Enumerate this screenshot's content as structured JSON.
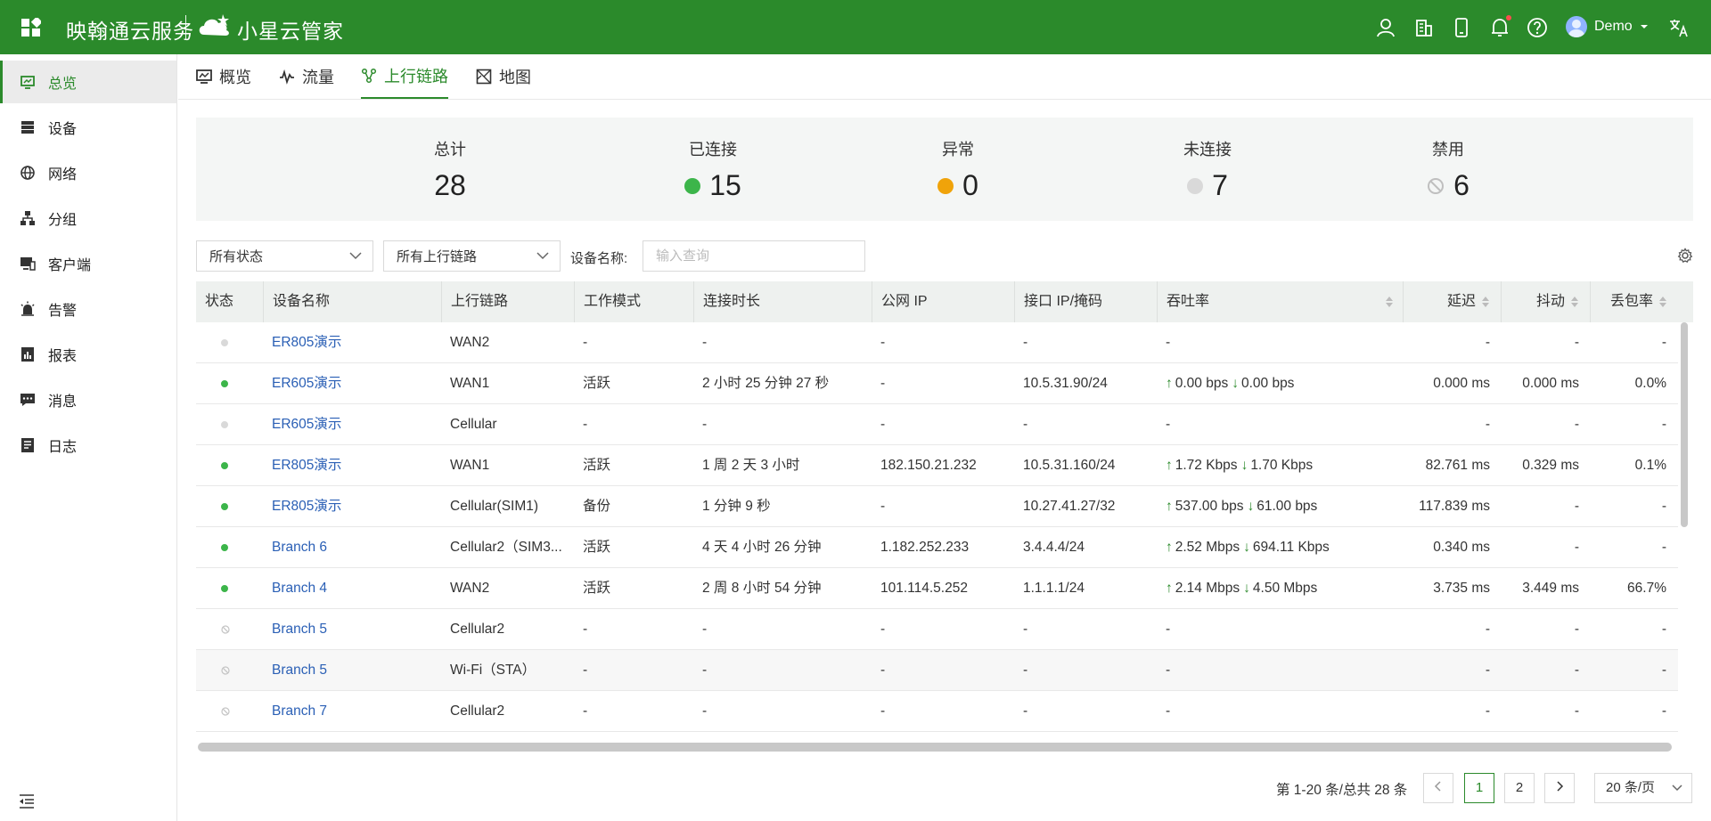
{
  "header": {
    "brand": "映翰通云服务",
    "product": "小星云管家",
    "user": "Demo",
    "accent": "#2b8a2b"
  },
  "sidebar": {
    "items": [
      {
        "label": "总览",
        "icon": "dashboard-icon",
        "active": true
      },
      {
        "label": "设备",
        "icon": "server-icon"
      },
      {
        "label": "网络",
        "icon": "globe-icon"
      },
      {
        "label": "分组",
        "icon": "hierarchy-icon"
      },
      {
        "label": "客户端",
        "icon": "client-icon"
      },
      {
        "label": "告警",
        "icon": "alarm-icon"
      },
      {
        "label": "报表",
        "icon": "report-icon"
      },
      {
        "label": "消息",
        "icon": "message-icon"
      },
      {
        "label": "日志",
        "icon": "log-icon"
      }
    ]
  },
  "tabs": [
    {
      "label": "概览",
      "icon": "monitor-icon"
    },
    {
      "label": "流量",
      "icon": "pulse-icon"
    },
    {
      "label": "上行链路",
      "icon": "uplink-icon",
      "active": true
    },
    {
      "label": "地图",
      "icon": "map-icon"
    }
  ],
  "stats": {
    "total": {
      "label": "总计",
      "value": "28"
    },
    "connected": {
      "label": "已连接",
      "value": "15",
      "color": "#3cb54a"
    },
    "abnormal": {
      "label": "异常",
      "value": "0",
      "color": "#f0a30a"
    },
    "disconnected": {
      "label": "未连接",
      "value": "7",
      "color": "#d9d9d9"
    },
    "disabled": {
      "label": "禁用",
      "value": "6",
      "color": "#bfbfbf"
    }
  },
  "filters": {
    "status": "所有状态",
    "uplink": "所有上行链路",
    "name_label": "设备名称:",
    "name_placeholder": "输入查询"
  },
  "table": {
    "columns": [
      "状态",
      "设备名称",
      "上行链路",
      "工作模式",
      "连接时长",
      "公网 IP",
      "接口 IP/掩码",
      "吞吐率",
      "延迟",
      "抖动",
      "丢包率"
    ],
    "rows": [
      {
        "status": "offline",
        "name": "ER805演示",
        "uplink": "WAN2",
        "mode": "-",
        "duration": "-",
        "public_ip": "-",
        "iface_ip": "-",
        "up": "",
        "down": "",
        "throughput": "-",
        "latency": "-",
        "jitter": "-",
        "loss": "-"
      },
      {
        "status": "online",
        "name": "ER605演示",
        "uplink": "WAN1",
        "mode": "活跃",
        "duration": "2 小时 25 分钟 27 秒",
        "public_ip": "-",
        "iface_ip": "10.5.31.90/24",
        "up": "0.00 bps",
        "down": "0.00 bps",
        "throughput": "",
        "latency": "0.000 ms",
        "jitter": "0.000 ms",
        "loss": "0.0%"
      },
      {
        "status": "offline",
        "name": "ER605演示",
        "uplink": "Cellular",
        "mode": "-",
        "duration": "-",
        "public_ip": "-",
        "iface_ip": "-",
        "up": "",
        "down": "",
        "throughput": "-",
        "latency": "-",
        "jitter": "-",
        "loss": "-"
      },
      {
        "status": "online",
        "name": "ER805演示",
        "uplink": "WAN1",
        "mode": "活跃",
        "duration": "1 周 2 天 3 小时",
        "public_ip": "182.150.21.232",
        "iface_ip": "10.5.31.160/24",
        "up": "1.72 Kbps",
        "down": "1.70 Kbps",
        "throughput": "",
        "latency": "82.761 ms",
        "jitter": "0.329 ms",
        "loss": "0.1%"
      },
      {
        "status": "online",
        "name": "ER805演示",
        "uplink": "Cellular(SIM1)",
        "mode": "备份",
        "duration": "1 分钟 9 秒",
        "public_ip": "-",
        "iface_ip": "10.27.41.27/32",
        "up": "537.00 bps",
        "down": "61.00 bps",
        "throughput": "",
        "latency": "117.839 ms",
        "jitter": "-",
        "loss": "-"
      },
      {
        "status": "online",
        "name": "Branch 6",
        "uplink": "Cellular2（SIM3...",
        "mode": "活跃",
        "duration": "4 天 4 小时 26 分钟",
        "public_ip": "1.182.252.233",
        "iface_ip": "3.4.4.4/24",
        "up": "2.52 Mbps",
        "down": "694.11 Kbps",
        "throughput": "",
        "latency": "0.340 ms",
        "jitter": "-",
        "loss": "-"
      },
      {
        "status": "online",
        "name": "Branch 4",
        "uplink": "WAN2",
        "mode": "活跃",
        "duration": "2 周 8 小时 54 分钟",
        "public_ip": "101.114.5.252",
        "iface_ip": "1.1.1.1/24",
        "up": "2.14 Mbps",
        "down": "4.50 Mbps",
        "throughput": "",
        "latency": "3.735 ms",
        "jitter": "3.449 ms",
        "loss": "66.7%"
      },
      {
        "status": "disabled",
        "name": "Branch 5",
        "uplink": "Cellular2",
        "mode": "-",
        "duration": "-",
        "public_ip": "-",
        "iface_ip": "-",
        "up": "",
        "down": "",
        "throughput": "-",
        "latency": "-",
        "jitter": "-",
        "loss": "-"
      },
      {
        "status": "disabled",
        "name": "Branch 5",
        "uplink": "Wi-Fi（STA）",
        "mode": "-",
        "duration": "-",
        "public_ip": "-",
        "iface_ip": "-",
        "up": "",
        "down": "",
        "throughput": "-",
        "latency": "-",
        "jitter": "-",
        "loss": "-",
        "alt": true
      },
      {
        "status": "disabled",
        "name": "Branch 7",
        "uplink": "Cellular2",
        "mode": "-",
        "duration": "-",
        "public_ip": "-",
        "iface_ip": "-",
        "up": "",
        "down": "",
        "throughput": "-",
        "latency": "-",
        "jitter": "-",
        "loss": "-"
      }
    ]
  },
  "pagination": {
    "info": "第 1-20 条/总共 28 条",
    "pages": [
      "1",
      "2"
    ],
    "current": "1",
    "page_size": "20 条/页"
  }
}
